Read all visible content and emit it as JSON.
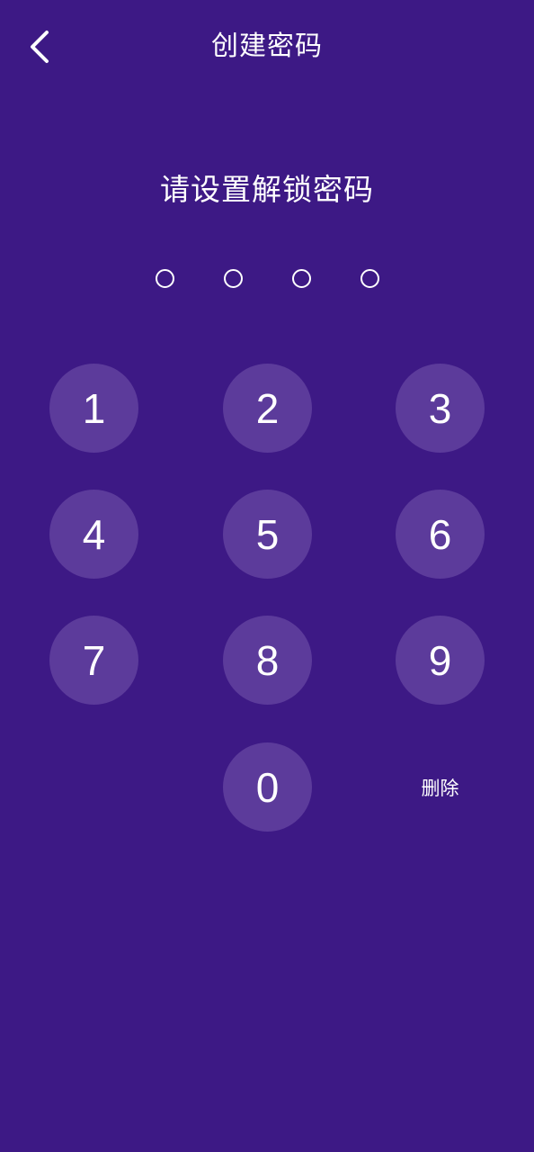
{
  "header": {
    "title": "创建密码",
    "back_icon": "chevron-left-icon"
  },
  "prompt": "请设置解锁密码",
  "pin": {
    "length": 4,
    "filled": 0
  },
  "keypad": {
    "keys": [
      "1",
      "2",
      "3",
      "4",
      "5",
      "6",
      "7",
      "8",
      "9",
      "0"
    ],
    "delete_label": "删除"
  },
  "colors": {
    "background": "#3d1985",
    "key_fill": "#5c3b9b",
    "text": "#ffffff"
  }
}
